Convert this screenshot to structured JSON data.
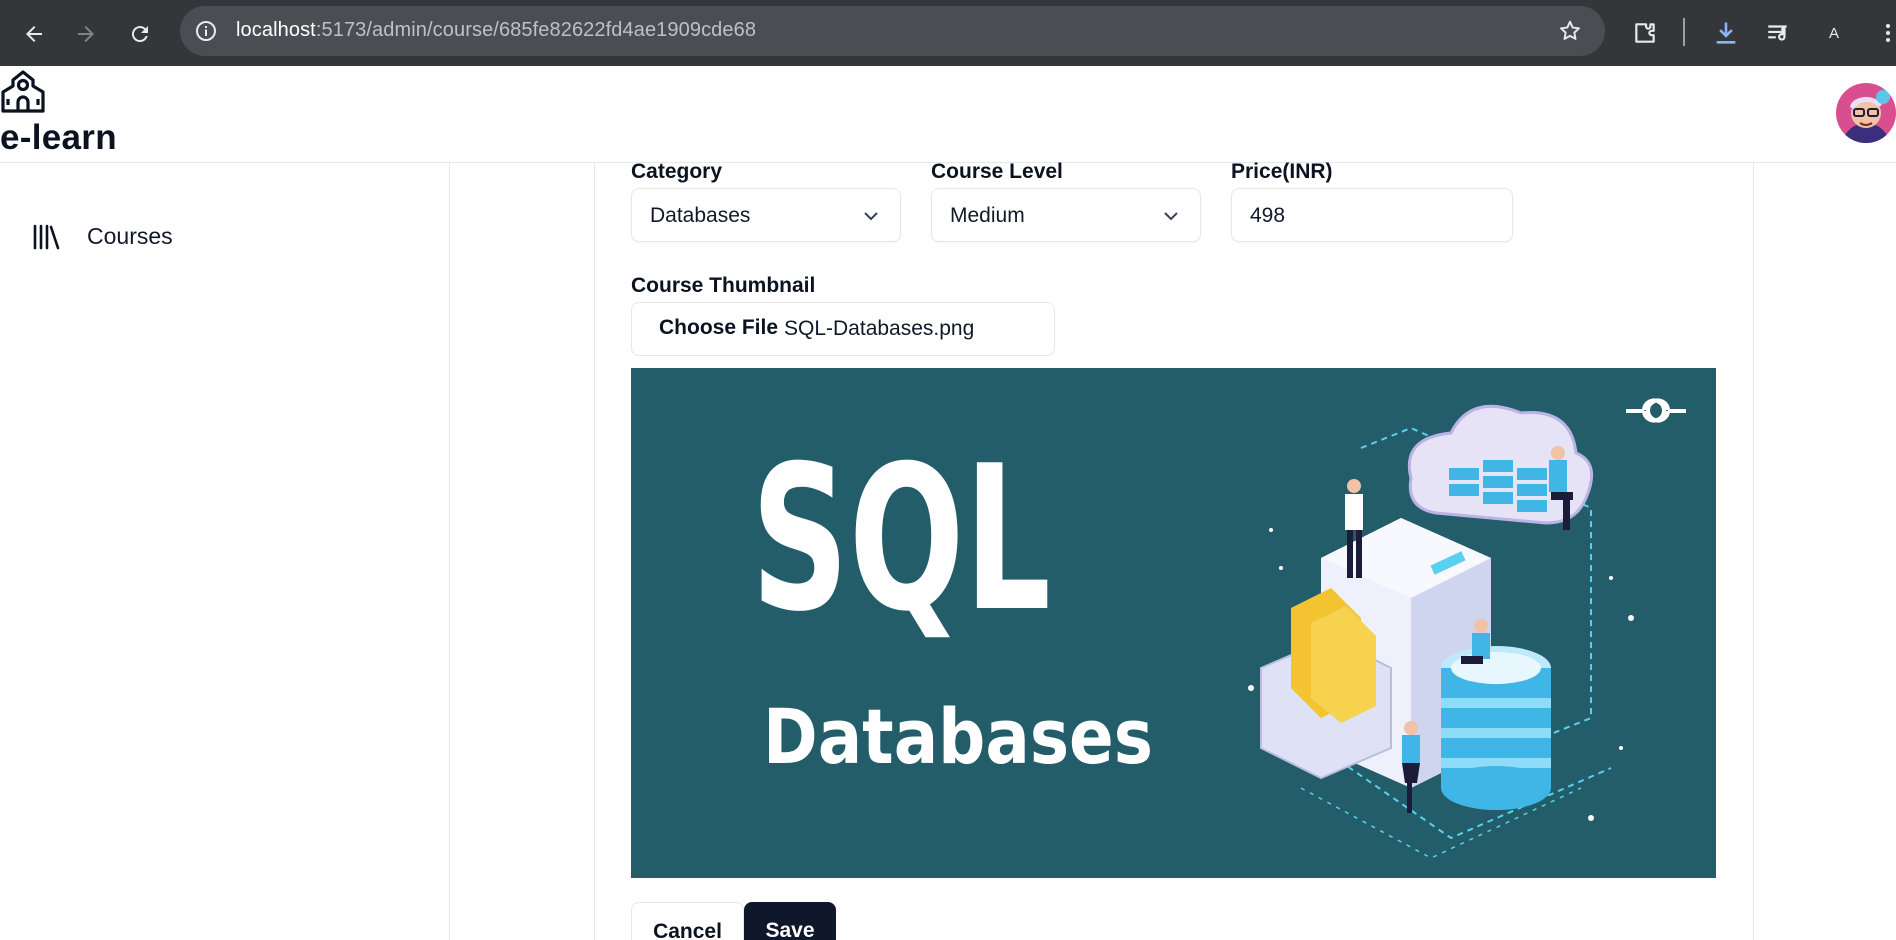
{
  "browser": {
    "url_host": "localhost",
    "url_path": ":5173/admin/course/685fe82622fd4ae1909cde68",
    "profile_initial": "A",
    "icons": [
      "back-arrow-icon",
      "forward-arrow-icon",
      "reload-icon",
      "site-info-icon",
      "bookmark-star-icon",
      "extensions-icon",
      "download-icon",
      "media-control-icon",
      "menu-dots-icon"
    ]
  },
  "header": {
    "brand": "e-learn",
    "logo_icon": "school-icon",
    "avatar": "user-avatar"
  },
  "sidebar": {
    "items": [
      {
        "label": "Courses",
        "icon": "library-icon"
      }
    ]
  },
  "form": {
    "category": {
      "label": "Category",
      "value": "Databases"
    },
    "course_level": {
      "label": "Course Level",
      "value": "Medium"
    },
    "price": {
      "label": "Price(INR)",
      "value": "498"
    },
    "thumbnail": {
      "label": "Course Thumbnail",
      "choose_label": "Choose File",
      "file_name": "SQL-Databases.png"
    },
    "preview": {
      "title": "SQL",
      "subtitle": "Databases",
      "background": "#235d6a"
    },
    "cancel_label": "Cancel",
    "save_label": "Save"
  },
  "colors": {
    "primary_button": "#0f172a",
    "browser_bar": "#35363a",
    "download_accent": "#8ab4f8"
  }
}
